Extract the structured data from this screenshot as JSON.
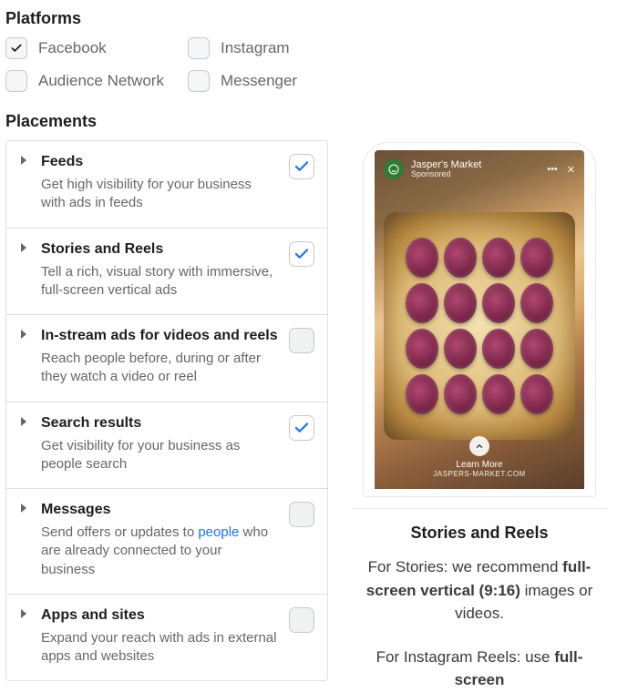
{
  "platforms": {
    "title": "Platforms",
    "items": [
      {
        "label": "Facebook",
        "checked": true
      },
      {
        "label": "Instagram",
        "checked": false
      },
      {
        "label": "Audience Network",
        "checked": false
      },
      {
        "label": "Messenger",
        "checked": false
      }
    ]
  },
  "placements": {
    "title": "Placements",
    "items": [
      {
        "title": "Feeds",
        "desc": "Get high visibility for your business with ads in feeds",
        "checked": true
      },
      {
        "title": "Stories and Reels",
        "desc": "Tell a rich, visual story with immersive, full-screen vertical ads",
        "checked": true
      },
      {
        "title": "In-stream ads for videos and reels",
        "desc": "Reach people before, during or after they watch a video or reel",
        "checked": false
      },
      {
        "title": "Search results",
        "desc": "Get visibility for your business as people search",
        "checked": true
      },
      {
        "title": "Messages",
        "desc_before": "Send offers or updates to ",
        "desc_link": "people",
        "desc_after": " who are already connected to your business",
        "checked": false
      },
      {
        "title": "Apps and sites",
        "desc": "Expand your reach with ads in external apps and websites",
        "checked": false
      }
    ]
  },
  "preview": {
    "advertiser": "Jasper's Market",
    "sponsored": "Sponsored",
    "cta_label": "Learn More",
    "cta_url": "JASPERS-MARKET.COM",
    "heading": "Stories and Reels",
    "p1_a": "For Stories: we recommend ",
    "p1_bold": "full-screen vertical (9:16)",
    "p1_b": " images or videos.",
    "p2_a": "For Instagram Reels: use ",
    "p2_bold": "full-screen"
  }
}
